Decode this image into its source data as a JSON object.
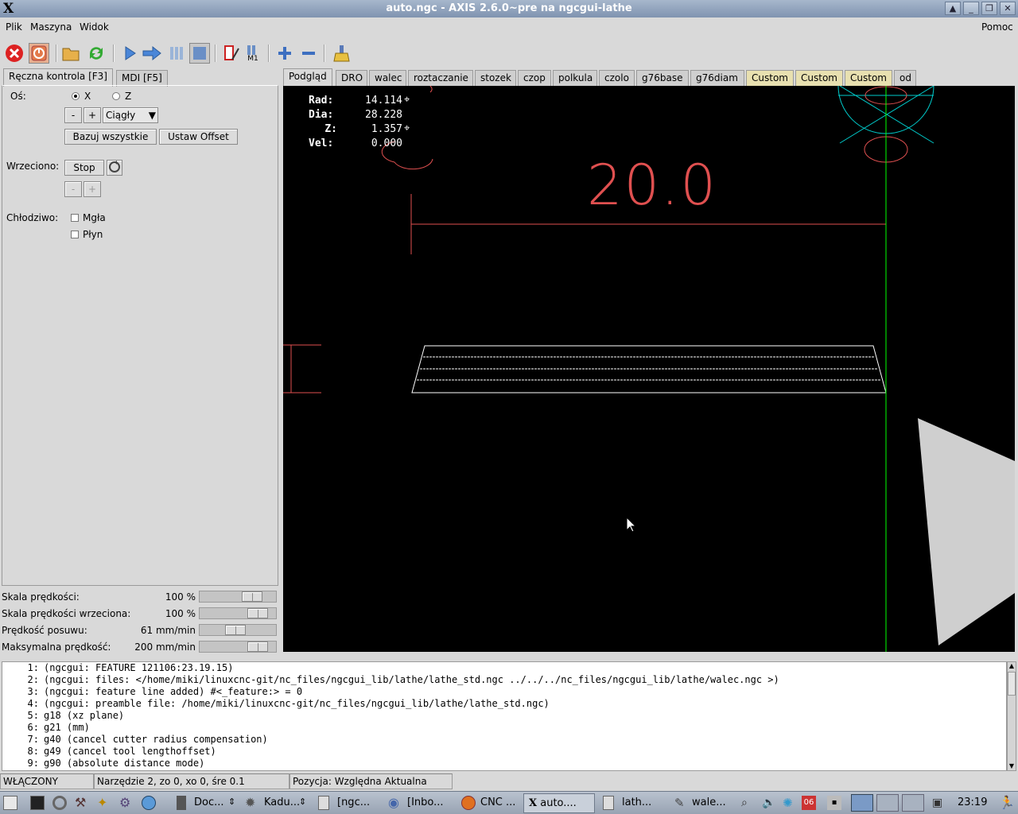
{
  "window": {
    "title": "auto.ngc - AXIS 2.6.0~pre na ngcgui-lathe"
  },
  "menu": {
    "items": [
      "Plik",
      "Maszyna",
      "Widok"
    ],
    "help": "Pomoc"
  },
  "toolbar": {
    "icons": [
      "estop-icon",
      "power-icon",
      "open-icon",
      "reload-icon",
      "run-icon",
      "step-icon",
      "pause-icon",
      "stop-icon",
      "block-delete-icon",
      "optional-stop-icon",
      "zoom-in-icon",
      "zoom-out-icon",
      "clear-plot-icon"
    ],
    "m1_label": "M1"
  },
  "left_tabs": [
    "Ręczna kontrola [F3]",
    "MDI [F5]"
  ],
  "manual": {
    "axis_label": "Oś:",
    "axis_x": "X",
    "axis_z": "Z",
    "minus": "-",
    "plus": "+",
    "jog_mode": "Ciągły",
    "home_all": "Bazuj wszystkie",
    "touch_off": "Ustaw Offset",
    "spindle_label": "Wrzeciono:",
    "spindle_stop": "Stop",
    "coolant_label": "Chłodziwo:",
    "mist": "Mgła",
    "flood": "Płyn"
  },
  "overrides": [
    {
      "label": "Skala prędkości:",
      "value": "100 %",
      "level": 0.75
    },
    {
      "label": "Skala prędkości wrzeciona:",
      "value": "100 %",
      "level": 0.85
    },
    {
      "label": "Prędkość posuwu:",
      "value": "61 mm/min",
      "level": 0.45
    },
    {
      "label": "Maksymalna prędkość:",
      "value": "200 mm/min",
      "level": 0.85
    }
  ],
  "right_tabs": [
    "Podgląd",
    "DRO",
    "walec",
    "roztaczanie",
    "stozek",
    "czop",
    "polkula",
    "czolo",
    "g76base",
    "g76diam",
    "Custom",
    "Custom",
    "Custom",
    "od"
  ],
  "dro": {
    "rad_label": "Rad:",
    "rad": "14.114",
    "dia_label": "Dia:",
    "dia": "28.228",
    "z_label": "Z:",
    "z": "1.357",
    "vel_label": "Vel:",
    "vel": "0.000"
  },
  "preview": {
    "dimension": "20.0",
    "colors": {
      "dimension": "#e05050",
      "axis": "#00ff00",
      "cone": "#00cccc",
      "path": "#ffffff",
      "tool": "#cfcfcf"
    }
  },
  "gcode": [
    {
      "n": "1:",
      "t": "(ngcgui: FEATURE 121106:23.19.15)"
    },
    {
      "n": "2:",
      "t": "(ngcgui: files: </home/miki/linuxcnc-git/nc_files/ngcgui_lib/lathe/lathe_std.ngc ../../../nc_files/ngcgui_lib/lathe/walec.ngc >)"
    },
    {
      "n": "3:",
      "t": "(ngcgui: feature line added) #<_feature:> = 0"
    },
    {
      "n": "4:",
      "t": "(ngcgui: preamble file: /home/miki/linuxcnc-git/nc_files/ngcgui_lib/lathe/lathe_std.ngc)"
    },
    {
      "n": "5:",
      "t": "g18 (xz plane)"
    },
    {
      "n": "6:",
      "t": "g21 (mm)"
    },
    {
      "n": "7:",
      "t": "g40 (cancel cutter radius compensation)"
    },
    {
      "n": "8:",
      "t": "g49 (cancel tool lengthoffset)"
    },
    {
      "n": "9:",
      "t": "g90 (absolute distance mode)"
    }
  ],
  "status": {
    "state": "WŁĄCZONY",
    "tool": "Narzędzie 2, zo 0, xo 0, śre 0.1",
    "position": "Pozycja: Względna Aktualna"
  },
  "taskbar": {
    "tasks": [
      "Doc...",
      "Kadu...",
      "[ngc...",
      "[Inbo...",
      "CNC ...",
      "auto....",
      "lath...",
      "wale..."
    ],
    "date_badge": "06",
    "clock": "23:19"
  }
}
